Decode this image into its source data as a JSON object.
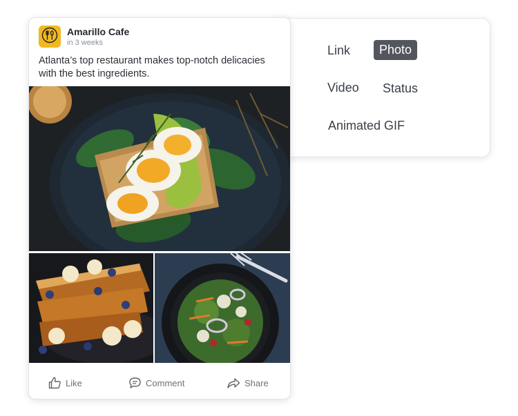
{
  "post": {
    "page_name": "Amarillo Cafe",
    "time": "in 3 weeks",
    "text": "Atlanta’s top restaurant makes top-notch delicacies with the best ingredients.",
    "actions": {
      "like": "Like",
      "comment": "Comment",
      "share": "Share"
    }
  },
  "post_types": {
    "link": "Link",
    "photo": "Photo",
    "video": "Video",
    "status": "Status",
    "gif": "Animated GIF",
    "selected": "Photo"
  },
  "colors": {
    "avatar_bg": "#f2b821",
    "selected_bg": "#53565d"
  },
  "icons": [
    "fork-spoon-icon",
    "thumbs-up-icon",
    "comment-icon",
    "share-icon"
  ],
  "images": [
    "egg-avocado-toast-photo",
    "french-toast-photo",
    "salad-bowl-photo"
  ]
}
